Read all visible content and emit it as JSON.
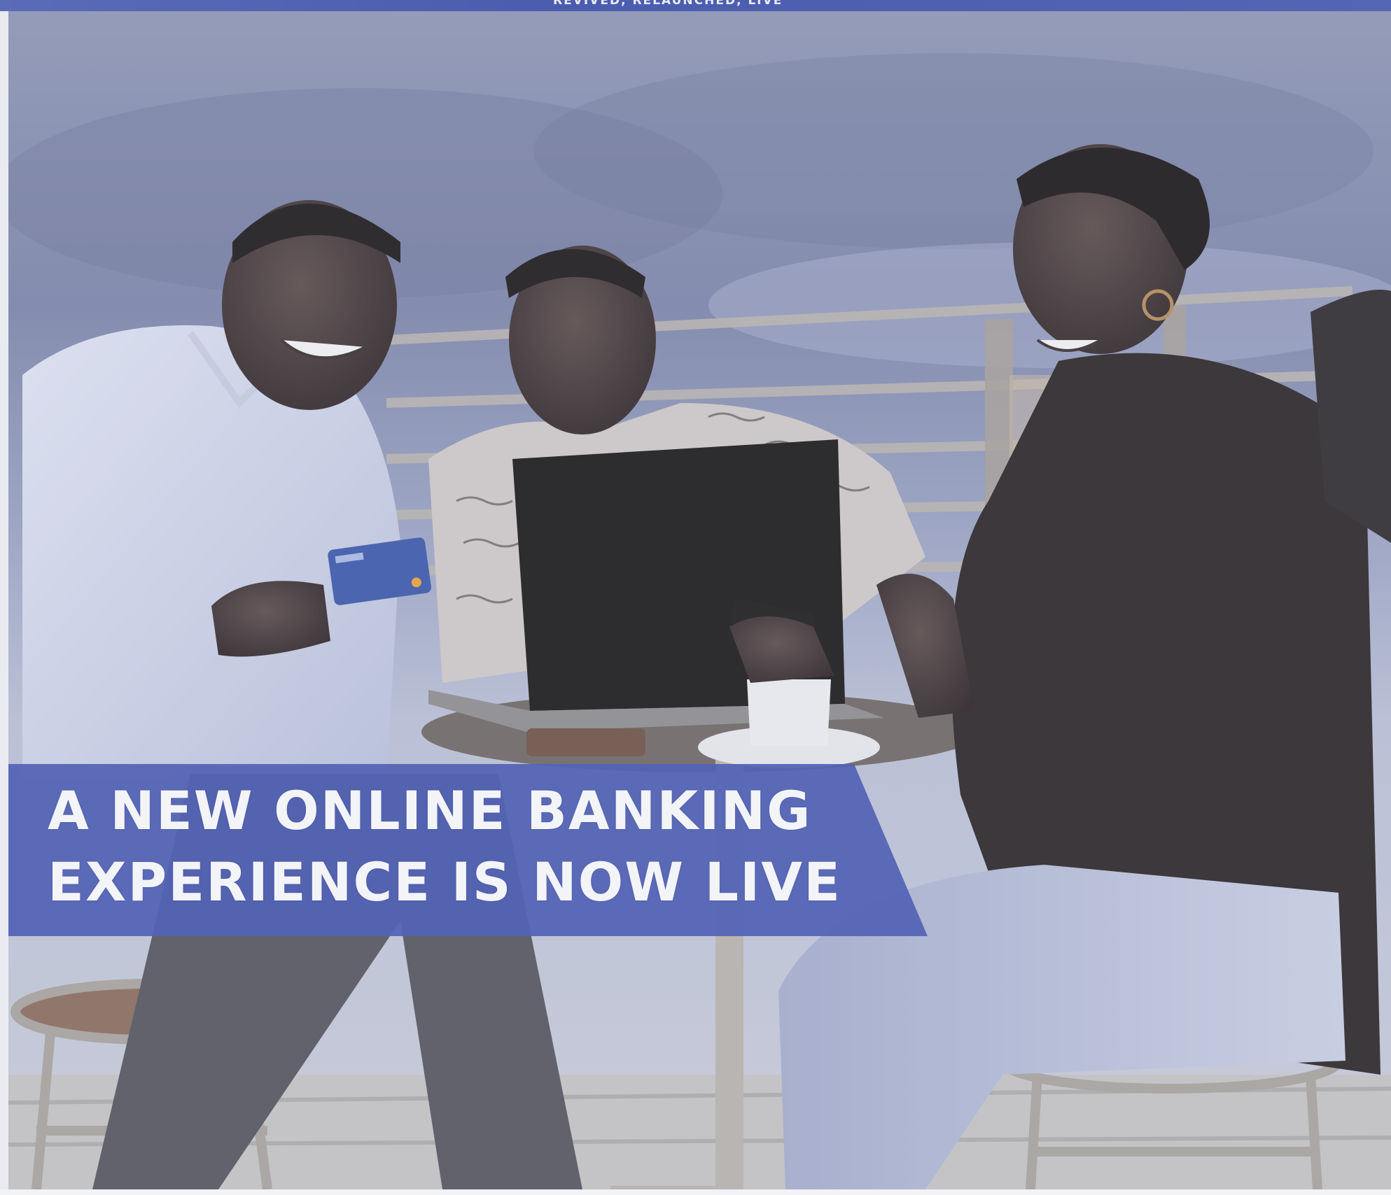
{
  "strip_text": "REVIVED, RELAUNCHED, LIVE",
  "headline": {
    "line1": "A NEW ONLINE BANKING",
    "line2": "EXPERIENCE IS NOW LIVE"
  },
  "colors": {
    "banner": "#5363b5",
    "strip": "#4f60b1",
    "headline_text": "#f3f4f8"
  }
}
